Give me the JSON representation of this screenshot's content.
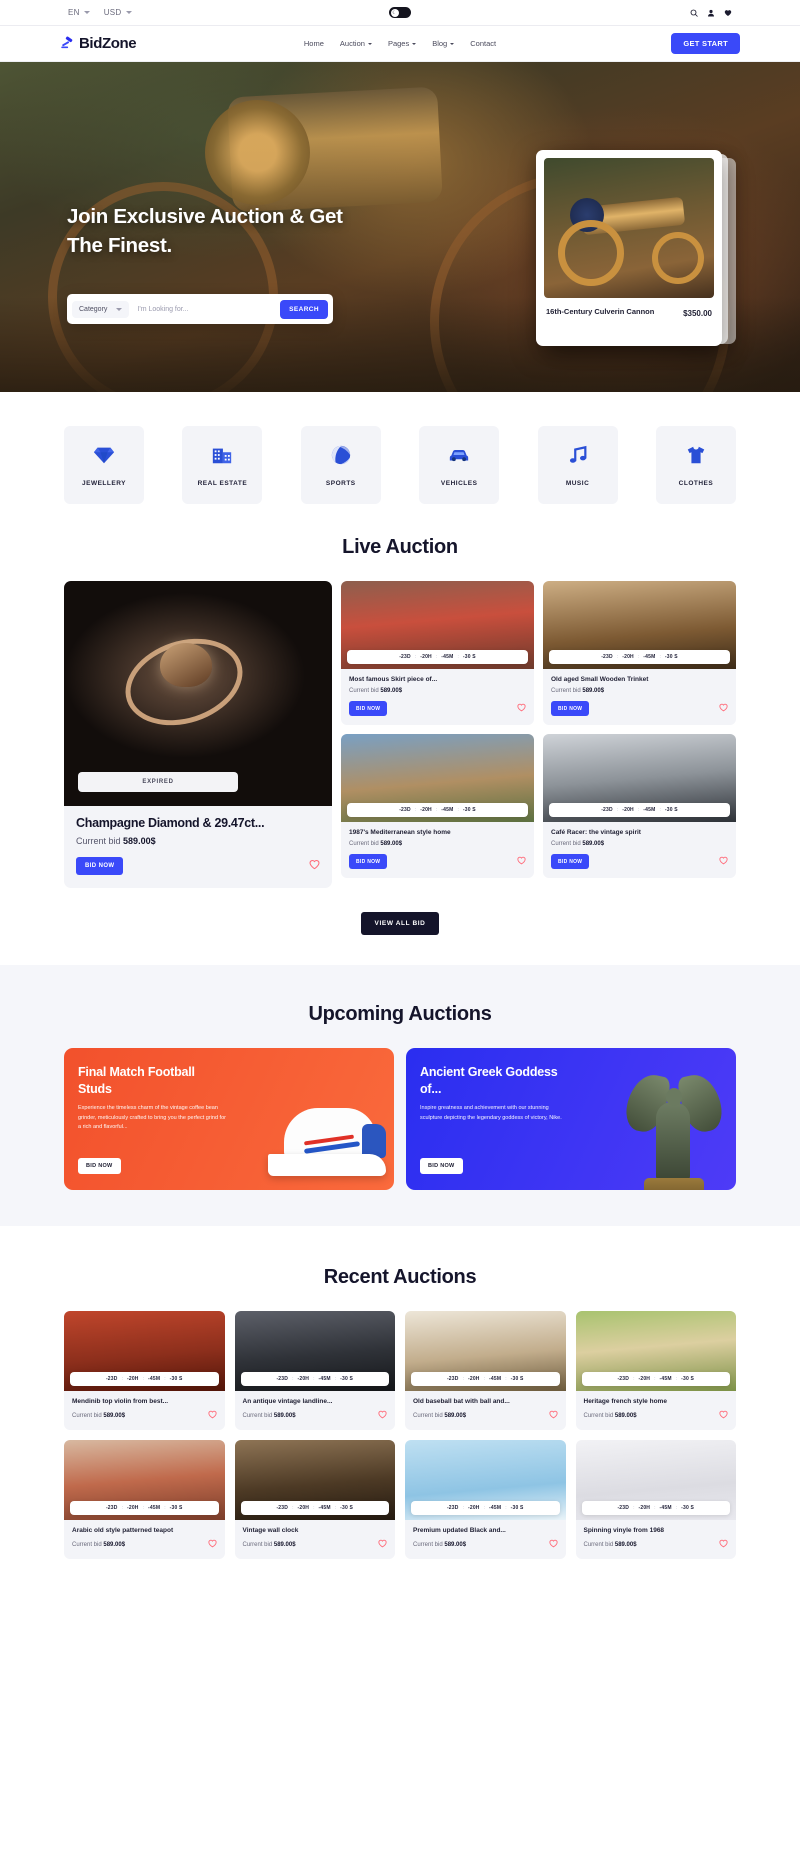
{
  "topbar": {
    "language": "EN",
    "currency": "USD",
    "icons": [
      "search-icon",
      "user-icon",
      "heart-icon"
    ],
    "theme_toggle": "dark-mode-toggle"
  },
  "nav": {
    "brand": "BidZone",
    "brand_icon": "gavel-icon",
    "items": [
      {
        "label": "Home",
        "dropdown": false
      },
      {
        "label": "Auction",
        "dropdown": true
      },
      {
        "label": "Pages",
        "dropdown": true
      },
      {
        "label": "Blog",
        "dropdown": true
      },
      {
        "label": "Contact",
        "dropdown": false
      }
    ],
    "cta": "GET START"
  },
  "hero": {
    "title_line1": "Join Exclusive Auction & Get",
    "title_line2": "The Finest.",
    "search": {
      "category_label": "Category",
      "placeholder": "I'm Looking for...",
      "button": "SEARCH"
    },
    "card": {
      "title": "16th-Century Culverin Cannon",
      "price": "$350.00"
    }
  },
  "categories": [
    {
      "label": "JEWELLERY",
      "icon": "diamond-icon"
    },
    {
      "label": "REAL ESTATE",
      "icon": "building-icon"
    },
    {
      "label": "SPORTS",
      "icon": "volleyball-icon"
    },
    {
      "label": "VEHICLES",
      "icon": "car-icon"
    },
    {
      "label": "MUSIC",
      "icon": "music-note-icon"
    },
    {
      "label": "CLOTHES",
      "icon": "tshirt-icon"
    }
  ],
  "live_auction": {
    "heading": "Live Auction",
    "featured": {
      "status": "EXPIRED",
      "title": "Champagne Diamond & 29.47ct...",
      "bid_label": "Current bid",
      "bid_value": "589.00$",
      "bid_button": "BID NOW"
    },
    "timer": {
      "d": "-23D",
      "h": "-20H",
      "m": "-45M",
      "s": "-30 S",
      "sep": ":"
    },
    "bid_label": "Current bid",
    "bid_value": "589.00$",
    "bid_button": "BID NOW",
    "items": [
      {
        "title": "Most famous Skirt piece of...",
        "img": "im-dress"
      },
      {
        "title": "Old aged Small Wooden Trinket",
        "img": "im-trinket"
      },
      {
        "title": "1987's Mediterranean style home",
        "img": "im-house"
      },
      {
        "title": "Café Racer: the vintage spirit",
        "img": "im-moto"
      }
    ],
    "view_all": "VIEW ALL BID"
  },
  "upcoming": {
    "heading": "Upcoming Auctions",
    "cards": [
      {
        "title": "Final Match Football Studs",
        "desc": "Experience the timeless charm of the vintage coffee bean grinder, meticulously crafted to bring you the perfect grind for a rich and flavorful...",
        "button": "BID NOW"
      },
      {
        "title": "Ancient Greek Goddess of...",
        "desc": "Inspire greatness and achievement with our stunning sculpture depicting the legendary goddess of victory, Nike.",
        "button": "BID NOW"
      }
    ]
  },
  "recent": {
    "heading": "Recent Auctions",
    "timer": {
      "d": "-23D",
      "h": "-20H",
      "m": "-45M",
      "s": "-30 S",
      "sep": ":"
    },
    "bid_label": "Current bid",
    "bid_value": "589.00$",
    "items": [
      {
        "title": "Mendinib top violin from best...",
        "img": "im-violin"
      },
      {
        "title": "An antique vintage landline...",
        "img": "im-phone"
      },
      {
        "title": "Old baseball bat with ball and...",
        "img": "im-ball"
      },
      {
        "title": "Heritage french style home",
        "img": "im-heritage"
      },
      {
        "title": "Arabic old style patterned teapot",
        "img": "im-teapot"
      },
      {
        "title": "Vintage wall clock",
        "img": "im-clock"
      },
      {
        "title": "Premium updated Black and...",
        "img": "im-bird"
      },
      {
        "title": "Spinning vinyle from 1968",
        "img": "im-vinyl"
      }
    ]
  },
  "colors": {
    "accent": "#3a49f9",
    "dark": "#14142a",
    "heart": "#ff6b7a"
  }
}
